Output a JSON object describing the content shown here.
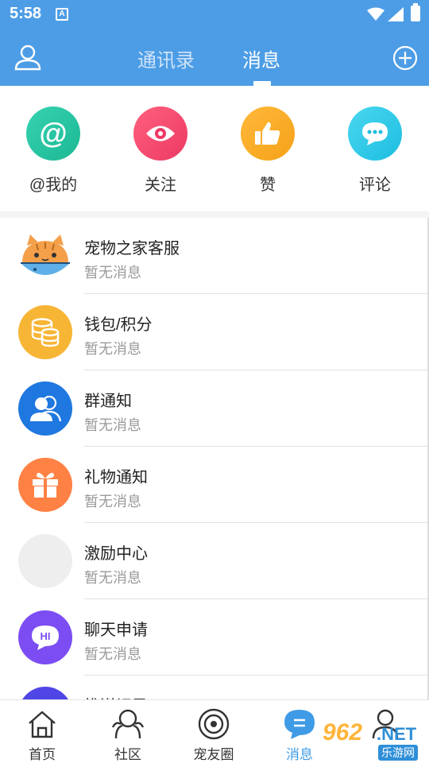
{
  "status_bar": {
    "time": "5:58",
    "notification_letter": "A"
  },
  "header": {
    "tabs": [
      {
        "label": "通讯录",
        "active": false
      },
      {
        "label": "消息",
        "active": true
      }
    ]
  },
  "quick_actions": [
    {
      "label": "@我的",
      "icon": "at-icon"
    },
    {
      "label": "关注",
      "icon": "eye-icon"
    },
    {
      "label": "赞",
      "icon": "thumbs-up-icon"
    },
    {
      "label": "评论",
      "icon": "comment-icon"
    }
  ],
  "messages": [
    {
      "title": "宠物之家客服",
      "subtitle": "暂无消息",
      "icon": "cat-fish-avatar"
    },
    {
      "title": "钱包/积分",
      "subtitle": "暂无消息",
      "icon": "coins-icon",
      "color": "#f7b535"
    },
    {
      "title": "群通知",
      "subtitle": "暂无消息",
      "icon": "group-users-icon",
      "color": "#1f78e0"
    },
    {
      "title": "礼物通知",
      "subtitle": "暂无消息",
      "icon": "gift-icon",
      "color": "#ff8144"
    },
    {
      "title": "激励中心",
      "subtitle": "暂无消息",
      "icon": "blank-avatar",
      "color": "#eeeeee"
    },
    {
      "title": "聊天申请",
      "subtitle": "暂无消息",
      "icon": "hi-chat-icon",
      "color": "#7b4df2"
    },
    {
      "title": "推送记录",
      "subtitle": "",
      "icon": "push-icon",
      "color": "#5046e6"
    }
  ],
  "bottom_nav": [
    {
      "label": "首页",
      "icon": "home-icon",
      "active": false
    },
    {
      "label": "社区",
      "icon": "community-icon",
      "active": false
    },
    {
      "label": "宠友圈",
      "icon": "pet-circle-icon",
      "active": false
    },
    {
      "label": "消息",
      "icon": "message-icon",
      "active": true
    },
    {
      "label": "",
      "icon": "profile-icon",
      "active": false
    }
  ],
  "watermark": {
    "number": "962",
    "domain": ".NET",
    "site_name": "乐游网"
  },
  "colors": {
    "primary": "#4d9de6",
    "active_tab": "#3f9be5"
  }
}
